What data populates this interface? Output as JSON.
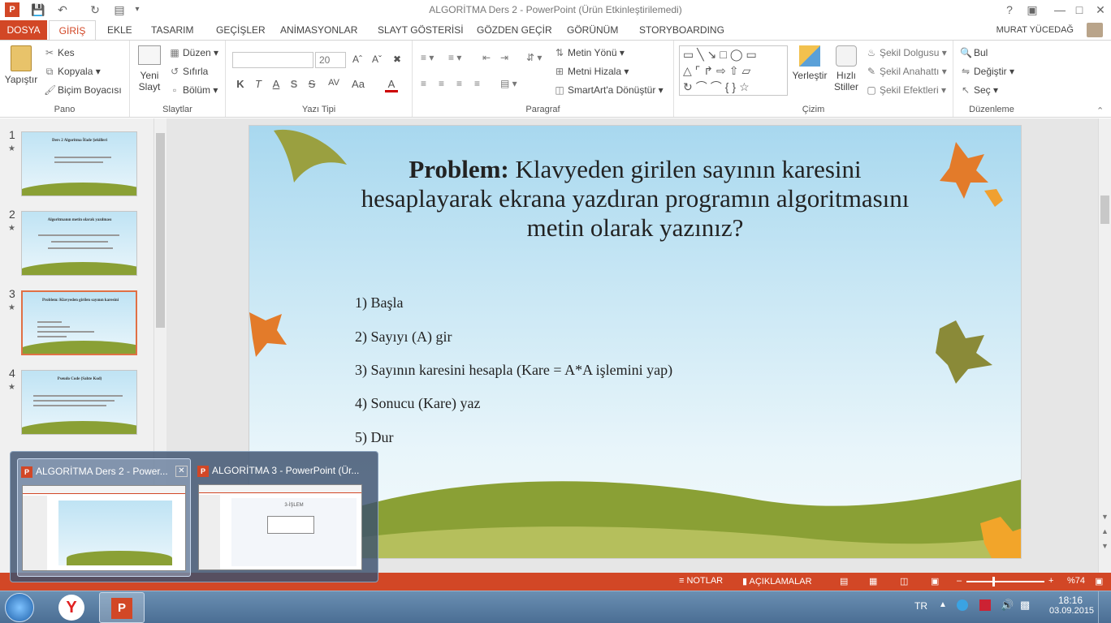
{
  "window": {
    "title": "ALGORİTMA Ders 2 - PowerPoint (Ürün Etkinleştirilemedi)",
    "user": "MURAT YÜCEDAĞ"
  },
  "tabs": [
    "DOSYA",
    "GİRİŞ",
    "EKLE",
    "TASARIM",
    "GEÇİŞLER",
    "ANİMASYONLAR",
    "SLAYT GÖSTERİSİ",
    "GÖZDEN GEÇİR",
    "GÖRÜNÜM",
    "STORYBOARDING"
  ],
  "ribbon": {
    "pano": {
      "label": "Pano",
      "paste": "Yapıştır",
      "cut": "Kes",
      "copy": "Kopyala",
      "painter": "Biçim Boyacısı"
    },
    "slaytlar": {
      "label": "Slaytlar",
      "new_slide": "Yeni Slayt",
      "layout": "Düzen",
      "reset": "Sıfırla",
      "section": "Bölüm"
    },
    "yazitipi": {
      "label": "Yazı Tipi",
      "font_size": "20",
      "bold": "K",
      "italic": "T",
      "underline": "A",
      "strike": "S",
      "spacing": "AV",
      "case": "Aa",
      "color": "A"
    },
    "paragraf": {
      "label": "Paragraf",
      "text_dir": "Metin Yönü",
      "align_text": "Metni Hizala",
      "smartart": "SmartArt'a Dönüştür"
    },
    "cizim": {
      "label": "Çizim",
      "arrange": "Yerleştir",
      "quick_styles": "Hızlı Stiller",
      "fill": "Şekil Dolgusu",
      "outline": "Şekil Anahattı",
      "effects": "Şekil Efektleri"
    },
    "duzenleme": {
      "label": "Düzenleme",
      "find": "Bul",
      "replace": "Değiştir",
      "select": "Seç"
    }
  },
  "thumbnails": [
    {
      "num": "1",
      "title": "Ders 2 Algoritma İfade Şekilleri"
    },
    {
      "num": "2",
      "title": "Algoritmanın metin olarak yazılması"
    },
    {
      "num": "3",
      "title": "Problem: Klavyeden girilen sayının karesini"
    },
    {
      "num": "4",
      "title": "Pseudo Code (Sahte Kod)"
    }
  ],
  "slide": {
    "title_bold": "Problem:",
    "title_rest": "Klavyeden girilen sayının karesini hesaplayarak ekrana yazdıran programın algoritmasını metin olarak yazınız?",
    "steps": [
      "1) Başla",
      "2) Sayıyı (A) gir",
      "3) Sayının karesini hesapla (Kare = A*A işlemini yap)",
      "4) Sonucu (Kare) yaz",
      "5) Dur"
    ]
  },
  "statusbar": {
    "notes": "NOTLAR",
    "comments": "AÇIKLAMALAR",
    "zoom": "%74"
  },
  "taskbar_preview": [
    {
      "title": "ALGORİTMA Ders 2 - Power..."
    },
    {
      "title": "ALGORİTMA 3 - PowerPoint (Ür..."
    }
  ],
  "preview_inner": {
    "label": "3-İŞLEM"
  },
  "tray": {
    "lang": "TR",
    "time": "18:16",
    "date": "03.09.2015"
  },
  "colors": {
    "accent": "#d24726",
    "hill": "#8aa035"
  }
}
